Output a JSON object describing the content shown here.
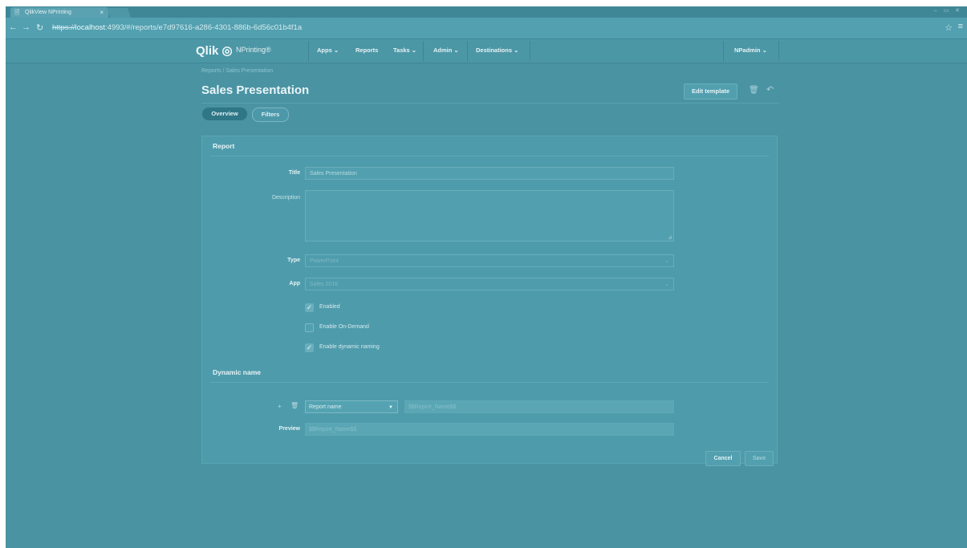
{
  "browser": {
    "tab_title": "QlikView NPrinting",
    "tab_close": "×",
    "url_prefix": "https://",
    "url_host": "localhost",
    "url_rest": ":4993/#/reports/e7d97616-a286-4301-886b-6d56c01b4f1a"
  },
  "header": {
    "logo": "Qlik",
    "product": "NPrinting®",
    "nav": [
      "Apps ⌄",
      "Reports",
      "Tasks ⌄",
      "Admin ⌄",
      "Destinations ⌄"
    ],
    "user": "NPadmin ⌄"
  },
  "page": {
    "breadcrumb": "Reports / Sales Presentation",
    "title": "Sales Presentation",
    "edit_template": "Edit template",
    "tabs": {
      "overview": "Overview",
      "filters": "Filters"
    }
  },
  "report": {
    "section": "Report",
    "title_label": "Title",
    "title_value": "Sales Presentation",
    "description_label": "Description",
    "type_label": "Type",
    "type_value": "PowerPoint",
    "app_label": "App",
    "app_value": "Sales 2016",
    "enabled": {
      "label": "Enabled",
      "checked": true
    },
    "on_demand": {
      "label": "Enable On-Demand",
      "checked": false
    },
    "dynamic_naming": {
      "label": "Enable dynamic naming",
      "checked": true
    }
  },
  "dynamic_name": {
    "section": "Dynamic name",
    "select_value": "Report name",
    "field_value": "$$Report_Name$$",
    "preview_label": "Preview",
    "preview_value": "$$Report_Name$$"
  },
  "actions": {
    "cancel": "Cancel",
    "save": "Save"
  }
}
